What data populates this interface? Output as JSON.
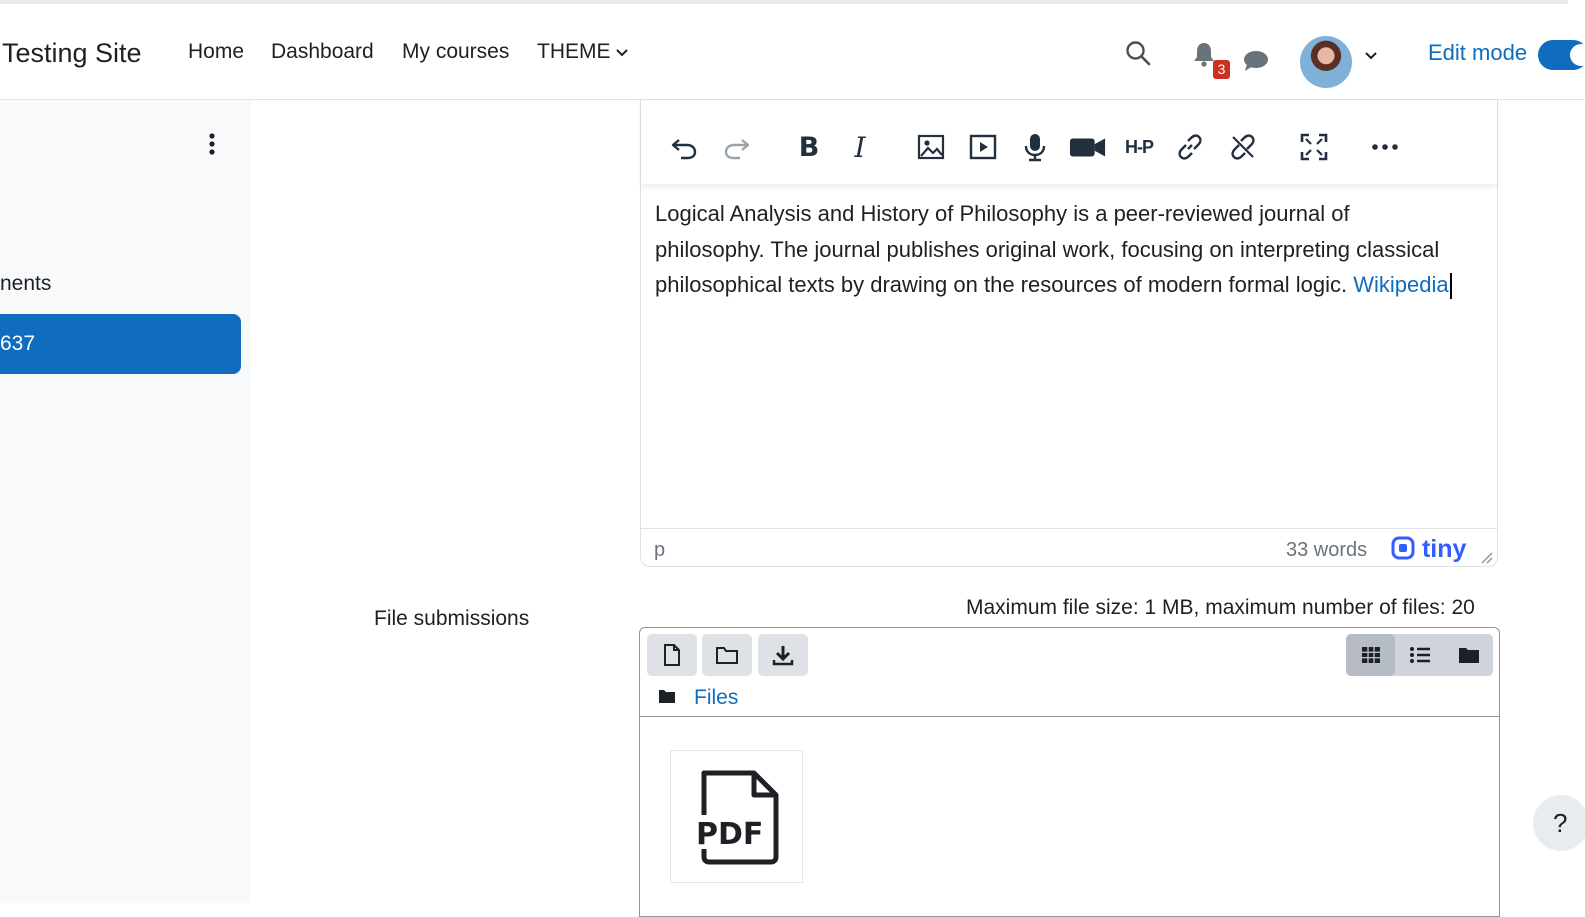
{
  "navbar": {
    "site_name": "Testing Site",
    "links": [
      "Home",
      "Dashboard",
      "My courses",
      "THEME"
    ],
    "notification_count": "3",
    "edit_mode_label": "Edit mode"
  },
  "drawer": {
    "section_label": "nents",
    "active_item": "637"
  },
  "editor": {
    "content_text": "Logical Analysis and History of Philosophy is a peer-reviewed journal of philosophy. The journal publishes original work, focusing on interpreting classical philosophical texts by drawing on the resources of modern formal logic. ",
    "link_text": "Wikipedia",
    "status_path": "p",
    "word_count": "33 words",
    "brand": "tiny",
    "toolbar_bold": "B",
    "toolbar_italic": "I",
    "toolbar_h5p": "H-P"
  },
  "file_submissions": {
    "label": "File submissions",
    "limits": "Maximum file size: 1 MB, maximum number of files: 20",
    "path_link": "Files",
    "file_type": "PDF"
  },
  "help": {
    "label": "?"
  },
  "colors": {
    "primary": "#0f6cbf",
    "badge": "#ca3120",
    "drawer_bg": "#f8f9fa"
  }
}
